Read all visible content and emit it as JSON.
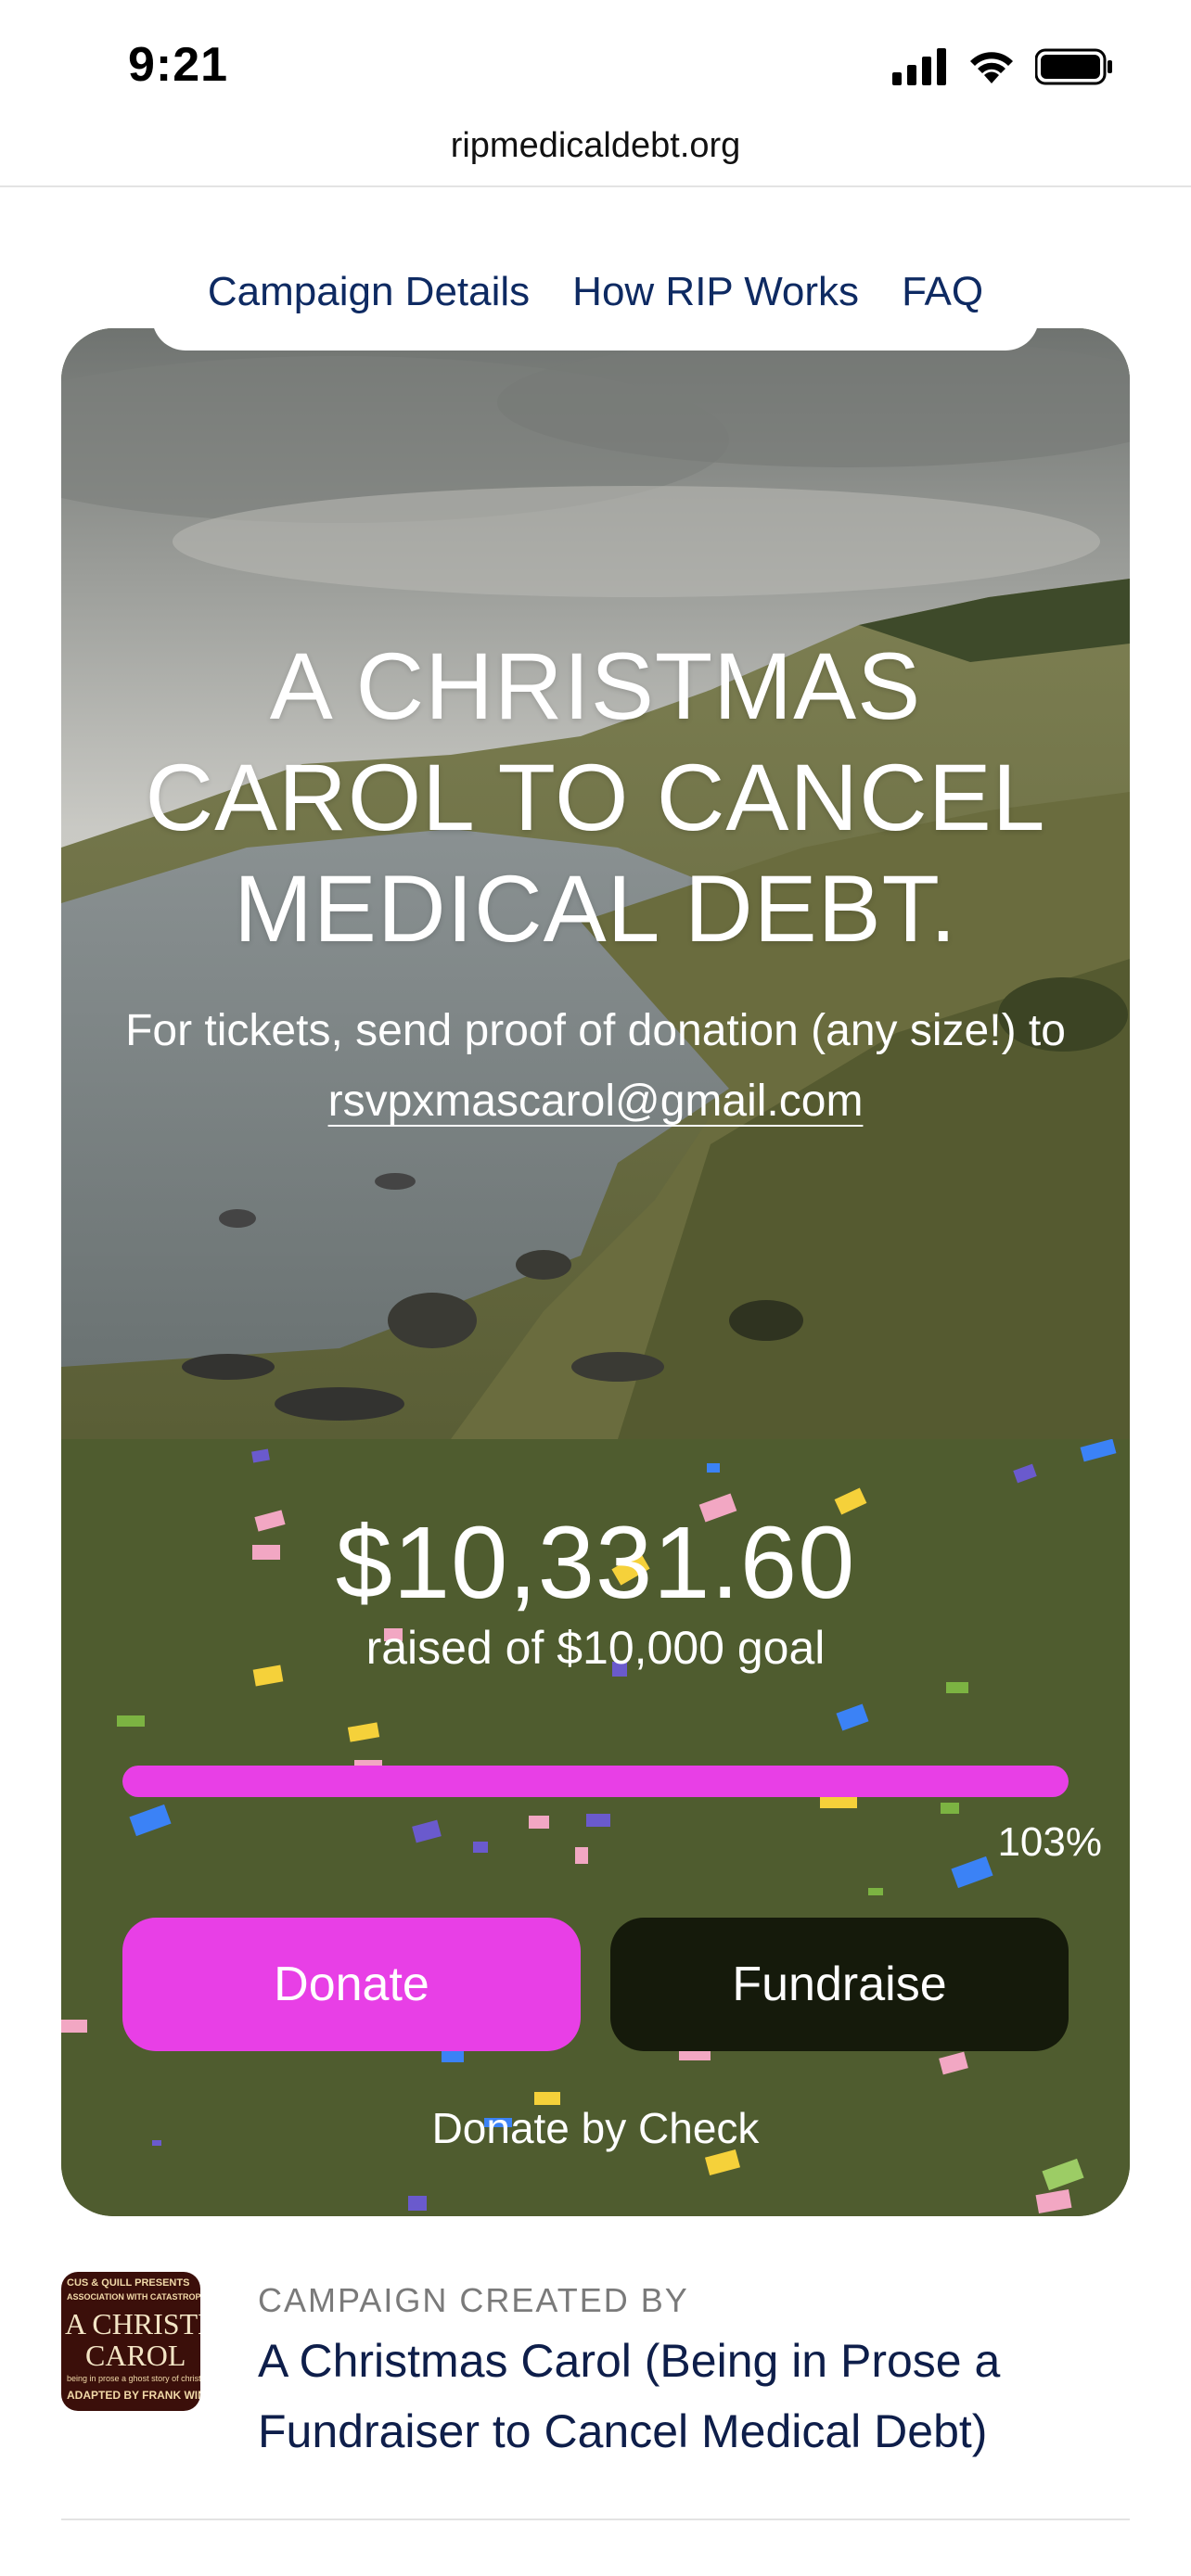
{
  "status_bar": {
    "time": "9:21",
    "icons": [
      "signal-icon",
      "wifi-icon",
      "battery-icon"
    ]
  },
  "browser": {
    "url": "ripmedicaldebt.org"
  },
  "nav": {
    "items": [
      "Campaign Details",
      "How RIP Works",
      "FAQ"
    ]
  },
  "hero": {
    "title_lines": [
      "A CHRISTMAS",
      "CAROL TO CANCEL",
      "MEDICAL DEBT."
    ],
    "subtitle_prefix": "For tickets, send proof of donation (any size!) to ",
    "email": "rsvpxmascarol@gmail.com"
  },
  "fundraiser": {
    "raised": "$10,331.60",
    "goal_text": "raised of $10,000 goal",
    "progress_fraction": 1.0,
    "percent_label": "103%",
    "donate_label": "Donate",
    "fundraise_label": "Fundraise",
    "check_label": "Donate by Check"
  },
  "creator": {
    "label": "CAMPAIGN CREATED BY",
    "name": "A Christmas Carol (Being in Prose a Fundraiser to Cancel Medical Debt)",
    "thumb_lines": [
      "CUS & QUILL PRESENTS",
      "ASSOCIATION WITH CATASTROPHE PLAYS",
      "A CHRISTMAS",
      "CAROL",
      "being in prose a ghost story of christmas",
      "ADAPTED BY FRANK WINTER"
    ]
  },
  "colors": {
    "nav_text": "#0e2a62",
    "card_green": "#4f5c2f",
    "accent_pink": "#e83fe6",
    "fundraise_dark": "#151a0b",
    "creator_name": "#0e1e4a"
  }
}
